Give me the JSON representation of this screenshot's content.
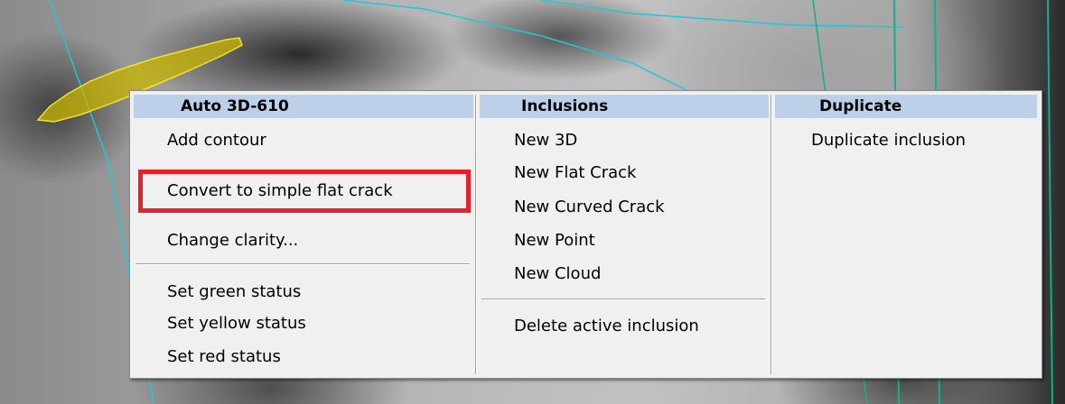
{
  "menu": {
    "columns": [
      {
        "header": "Auto 3D-610",
        "items": [
          "Add contour",
          "Convert to simple flat crack",
          "Change clarity...",
          "Set green status",
          "Set yellow status",
          "Set red status"
        ]
      },
      {
        "header": "Inclusions",
        "items": [
          "New 3D",
          "New Flat Crack",
          "New Curved Crack",
          "New Point",
          "New Cloud",
          "Delete active inclusion"
        ]
      },
      {
        "header": "Duplicate",
        "items": [
          "Duplicate inclusion"
        ]
      }
    ]
  },
  "colors": {
    "header_bg": "#bcd0ea",
    "menu_bg": "#f0f0f0",
    "highlight": "#e8202a",
    "contour_cyan": "#1ec8d8",
    "selected_contour_fill": "#c8b400"
  }
}
